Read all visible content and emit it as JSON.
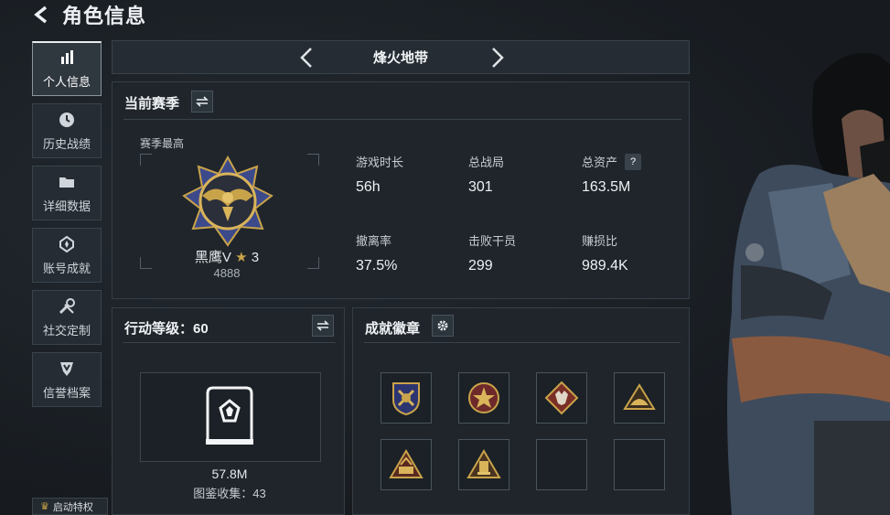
{
  "header": {
    "title": "角色信息"
  },
  "sidebar": {
    "items": [
      {
        "label": "个人信息",
        "icon": "bar-chart-icon",
        "active": true
      },
      {
        "label": "历史战绩",
        "icon": "clock-icon"
      },
      {
        "label": "详细数据",
        "icon": "folder-icon"
      },
      {
        "label": "账号成就",
        "icon": "medal-icon"
      },
      {
        "label": "社交定制",
        "icon": "tools-icon"
      },
      {
        "label": "信誉档案",
        "icon": "shield-icon"
      }
    ],
    "start_privilege": "启动特权"
  },
  "mode": {
    "name": "烽火地带"
  },
  "season": {
    "title": "当前赛季",
    "best_label": "赛季最高",
    "rank_name": "黑鹰V",
    "rank_stars": "3",
    "rank_score": "4888",
    "stats": [
      {
        "label": "游戏时长",
        "value": "56h"
      },
      {
        "label": "总战局",
        "value": "301"
      },
      {
        "label": "总资产",
        "value": "163.5M",
        "help": "?"
      },
      {
        "label": "撤离率",
        "value": "37.5%"
      },
      {
        "label": "击败干员",
        "value": "299"
      },
      {
        "label": "赚损比",
        "value": "989.4K"
      }
    ]
  },
  "action_level": {
    "title": "行动等级：60",
    "value": "57.8M",
    "collection": "图鉴收集：43"
  },
  "achievements": {
    "title": "成就徽章",
    "medals": [
      "shield-badge-icon",
      "star-wreath-badge-icon",
      "wolf-diamond-badge-icon",
      "mountain-triangle-badge-icon",
      "number-triangle-badge-icon",
      "tower-triangle-badge-icon",
      "empty",
      "empty"
    ]
  },
  "colors": {
    "accent": "#c9a34a",
    "panel": "#1f252b",
    "border": "#353e47"
  }
}
